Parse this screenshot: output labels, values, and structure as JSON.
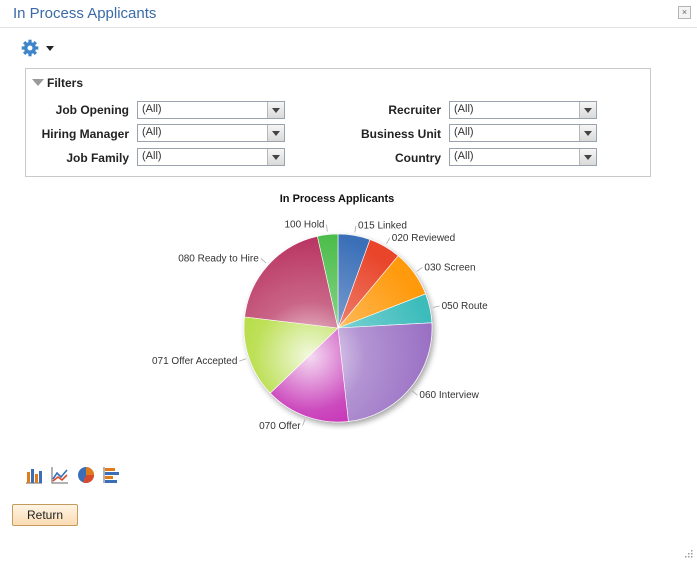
{
  "window": {
    "title": "In Process Applicants",
    "close_label": "×"
  },
  "toolbar": {
    "gear_icon": "gear-icon",
    "menu_icon": "chevron-down-icon"
  },
  "filters": {
    "title": "Filters",
    "left": [
      {
        "label": "Job Opening",
        "value": "(All)"
      },
      {
        "label": "Hiring Manager",
        "value": "(All)"
      },
      {
        "label": "Job Family",
        "value": "(All)"
      }
    ],
    "right": [
      {
        "label": "Recruiter",
        "value": "(All)"
      },
      {
        "label": "Business Unit",
        "value": "(All)"
      },
      {
        "label": "Country",
        "value": "(All)"
      }
    ]
  },
  "chart_data": {
    "type": "pie",
    "title": "In Process Applicants",
    "slices": [
      {
        "label": "015 Linked",
        "value": 5.5,
        "color": "#3a6fb8"
      },
      {
        "label": "020 Reviewed",
        "value": 5.5,
        "color": "#e8452a"
      },
      {
        "label": "030 Screen",
        "value": 8.0,
        "color": "#ff9a10"
      },
      {
        "label": "050 Route",
        "value": 5.0,
        "color": "#3dbcbc"
      },
      {
        "label": "060 Interview",
        "value": 24.0,
        "color": "#9a6fc4"
      },
      {
        "label": "070 Offer",
        "value": 14.5,
        "color": "#bb0aa8"
      },
      {
        "label": "071 Offer Accepted",
        "value": 14.0,
        "color": "#a8d622"
      },
      {
        "label": "080 Ready to Hire",
        "value": 19.5,
        "color": "#b83060"
      },
      {
        "label": "100 Hold",
        "value": 3.5,
        "color": "#4cbd4c"
      }
    ]
  },
  "chart_types": [
    "bar-chart-icon",
    "line-chart-icon",
    "pie-chart-icon",
    "horizontal-bar-chart-icon"
  ],
  "actions": {
    "return_label": "Return"
  }
}
